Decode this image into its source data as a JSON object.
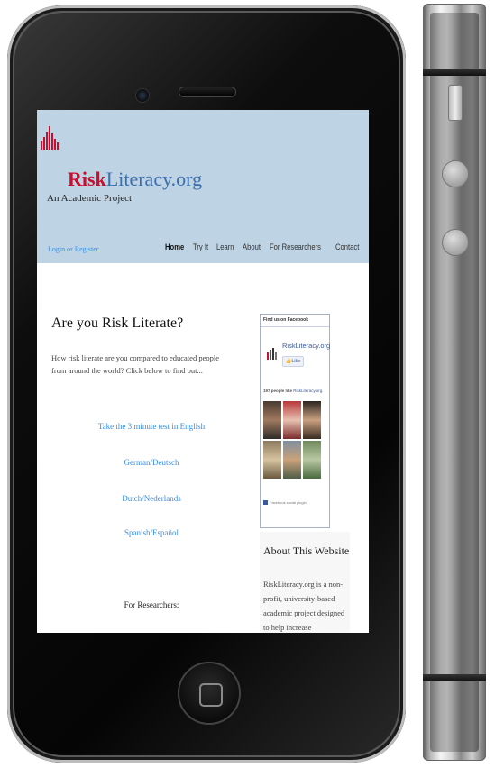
{
  "site": {
    "logo_brand": "Risk",
    "logo_rest": "Literacy.org",
    "logo_subtitle": "An Academic Project",
    "login_link": "Login or Register",
    "nav": [
      "Home",
      "Try It",
      "Learn",
      "About",
      "For Researchers",
      "Contact"
    ],
    "nav_active": "Home"
  },
  "main": {
    "heading": "Are you Risk Literate?",
    "intro": "How risk literate are you compared to educated people from around the world? Click below to find out...",
    "links": [
      "Take the 3 minute test in English",
      "German/Deutsch",
      "Dutch/Nederlands",
      "Spanish/Español"
    ],
    "researchers": "For Researchers:"
  },
  "facebook": {
    "header": "Find us on Facebook",
    "page_name": "RiskLiteracy.org",
    "like_label": "Like",
    "people_count": "197 people like",
    "people_target": "RiskLiteracy.org",
    "plugin_label": "Facebook social plugin"
  },
  "about": {
    "heading": "About  This Website",
    "text": "RiskLiteracy.org is a non-profit, university-based academic project designed to help increase"
  },
  "colors": {
    "banner": "#bed3e3",
    "brand_red": "#c8102e",
    "brand_blue": "#3c6fb0",
    "link_blue": "#3a8de0",
    "facebook_blue": "#3b5998"
  },
  "icons": [
    "logo-bars-icon",
    "facebook-logo-icon",
    "facebook-thumb-icon",
    "home-square-icon"
  ]
}
